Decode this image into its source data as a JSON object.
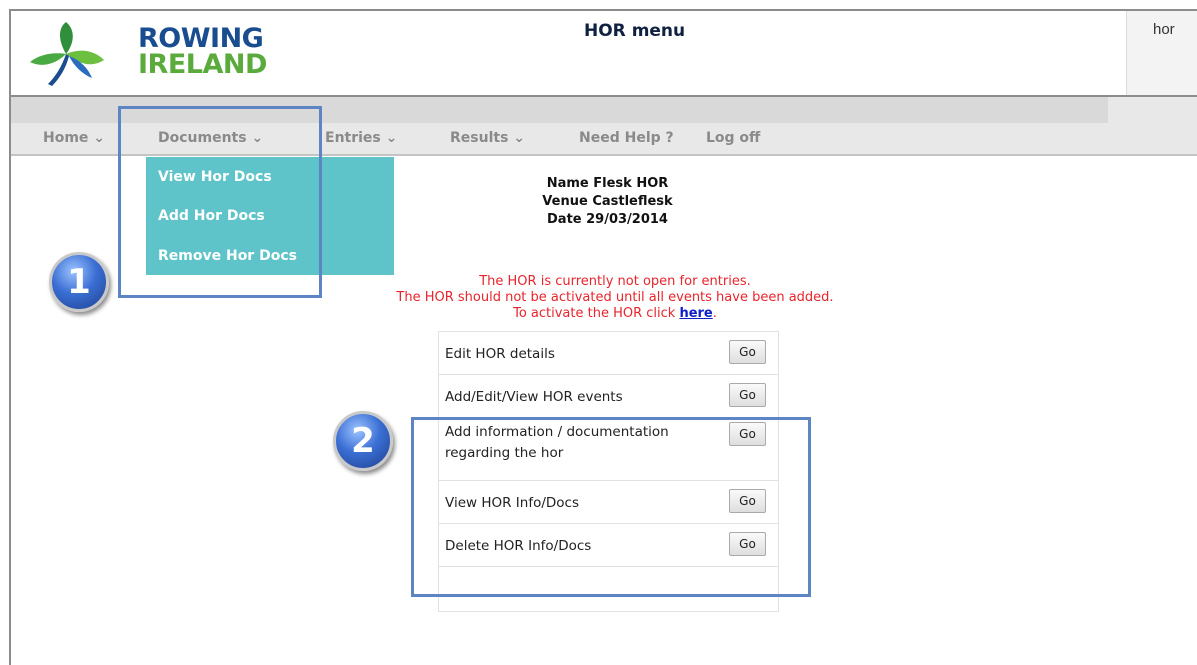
{
  "header": {
    "brand_line1": "ROWING",
    "brand_line2": "IRELAND",
    "title": "HOR menu",
    "user": "hor"
  },
  "nav": {
    "items": [
      {
        "label": "Home ⌄"
      },
      {
        "label": "Documents ⌄"
      },
      {
        "label": "Entries ⌄"
      },
      {
        "label": "Results ⌄"
      },
      {
        "label": "Need Help ?"
      },
      {
        "label": "Log off"
      }
    ]
  },
  "documents_menu": {
    "items": [
      {
        "label": "View Hor Docs"
      },
      {
        "label": "Add Hor Docs"
      },
      {
        "label": "Remove Hor Docs"
      }
    ]
  },
  "hor_info": {
    "name": "Name Flesk HOR",
    "venue": "Venue Castleflesk",
    "date": "Date 29/03/2014"
  },
  "notice": {
    "line1": "The HOR is currently not open for entries.",
    "line2": "The HOR should not be activated until all events have been added.",
    "line3_prefix": "To activate the HOR click ",
    "link": "here",
    "line3_suffix": "."
  },
  "actions": {
    "go_label": "Go",
    "rows": [
      {
        "label": "Edit HOR details"
      },
      {
        "label": "Add/Edit/View HOR events"
      },
      {
        "label": "Add information / documentation regarding the hor"
      },
      {
        "label": "View HOR Info/Docs"
      },
      {
        "label": "Delete HOR Info/Docs"
      }
    ]
  },
  "annotations": {
    "badge1": "1",
    "badge2": "2",
    "highlight_color": "#5d85c4"
  },
  "colors": {
    "brand_blue": "#1a4d8f",
    "brand_green": "#5aaa3c",
    "dropdown_bg": "#5fc4c9",
    "notice_red": "#e8242c",
    "link_blue": "#1020c8"
  }
}
